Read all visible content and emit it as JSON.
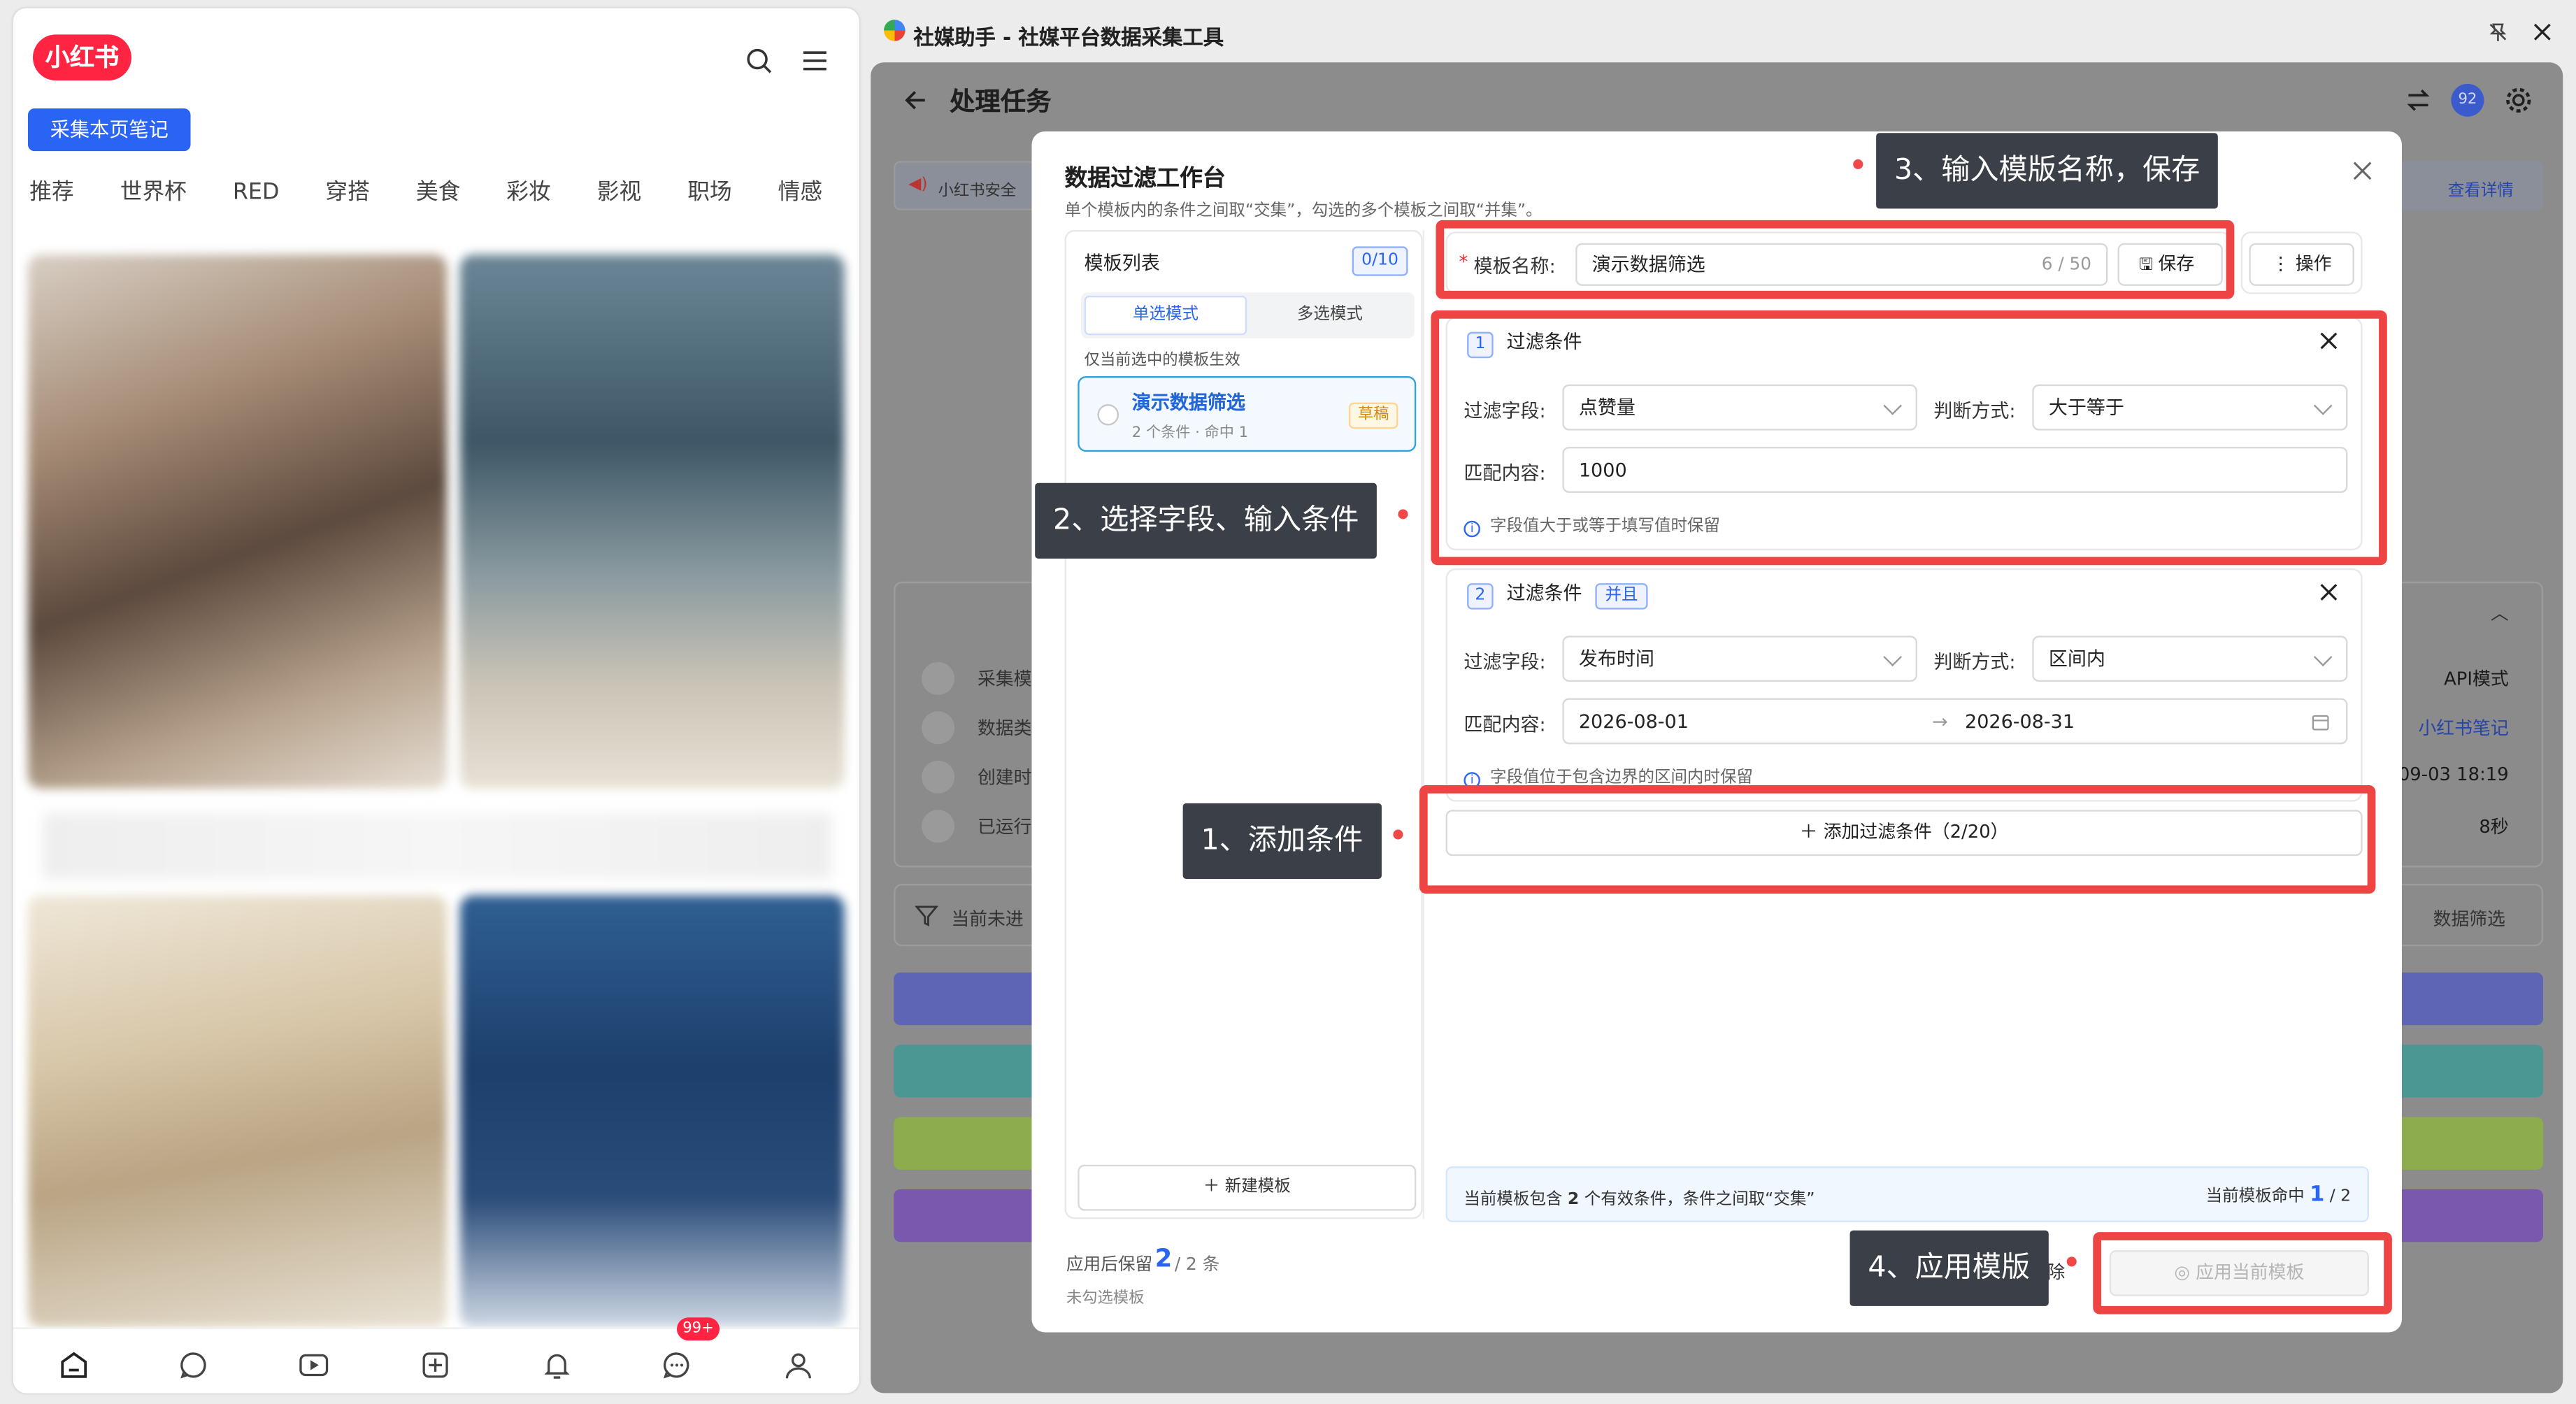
{
  "xhs": {
    "logo": "小红书",
    "collect_btn": "采集本页笔记",
    "categories": [
      "推荐",
      "世界杯",
      "RED",
      "穿搭",
      "美食",
      "彩妆",
      "影视",
      "职场",
      "情感"
    ],
    "badge": "99+"
  },
  "window": {
    "title": "社媒助手 - 社媒平台数据采集工具"
  },
  "app": {
    "header_title": "处理任务",
    "avatar": "92",
    "notice": "小红书安全",
    "detail_link": "查看详情",
    "info_rows": [
      {
        "label": "采集模",
        "value": "API模式"
      },
      {
        "label": "数据类",
        "value": "小红书笔记"
      },
      {
        "label": "创建时",
        "value": "09-03 18:19"
      },
      {
        "label": "已运行",
        "value": "8秒"
      }
    ],
    "filter_left": "当前未进",
    "filter_right": "数据筛选",
    "colors": {
      "blue": "#3646d6",
      "teal": "#16a19b",
      "green": "#8cc61a",
      "purple": "#6a2ec8"
    }
  },
  "modal": {
    "title": "数据过滤工作台",
    "subtitle": "单个模板内的条件之间取“交集”，勾选的多个模板之间取“并集”。",
    "template_list_title": "模板列表",
    "template_count": "0/10",
    "mode_single": "单选模式",
    "mode_multi": "多选模式",
    "mode_hint": "仅当前选中的模板生效",
    "template": {
      "name": "演示数据筛选",
      "meta": "2 个条件 · 命中 1",
      "tag": "草稿"
    },
    "new_template": "新建模板",
    "keep_label": "应用后保留",
    "keep_count": "2",
    "keep_total": "/ 2 条",
    "unchecked": "未勾选模板",
    "name_label": "模板名称:",
    "name_value": "演示数据筛选",
    "name_counter": "6 / 50",
    "save": "保存",
    "ops": "操作",
    "conditions": [
      {
        "index": "1",
        "title": "过滤条件",
        "field_label": "过滤字段:",
        "field_value": "点赞量",
        "mode_label": "判断方式:",
        "mode_value": "大于等于",
        "match_label": "匹配内容:",
        "match_value": "1000",
        "hint": "字段值大于或等于填写值时保留"
      },
      {
        "index": "2",
        "title": "过滤条件",
        "tag": "并且",
        "field_label": "过滤字段:",
        "field_value": "发布时间",
        "mode_label": "判断方式:",
        "mode_value": "区间内",
        "match_label": "匹配内容:",
        "date_start": "2026-08-01",
        "date_end": "2026-08-31",
        "hint": "字段值位于包含边界的区间内时保留"
      }
    ],
    "add_condition": "添加过滤条件（2/20）",
    "summary_left_1": "当前模板包含 ",
    "summary_count": "2",
    "summary_left_2": " 个有效条件，条件之间取“交集”",
    "summary_right_1": "当前模板命中 ",
    "summary_hit": "1",
    "summary_right_2": " / 2",
    "apply": "应用当前模板",
    "clear_partial": "除"
  },
  "callouts": {
    "step1": "1、添加条件",
    "step2": "2、选择字段、输入条件",
    "step3": "3、输入模版名称，保存",
    "step4": "4、应用模版"
  }
}
